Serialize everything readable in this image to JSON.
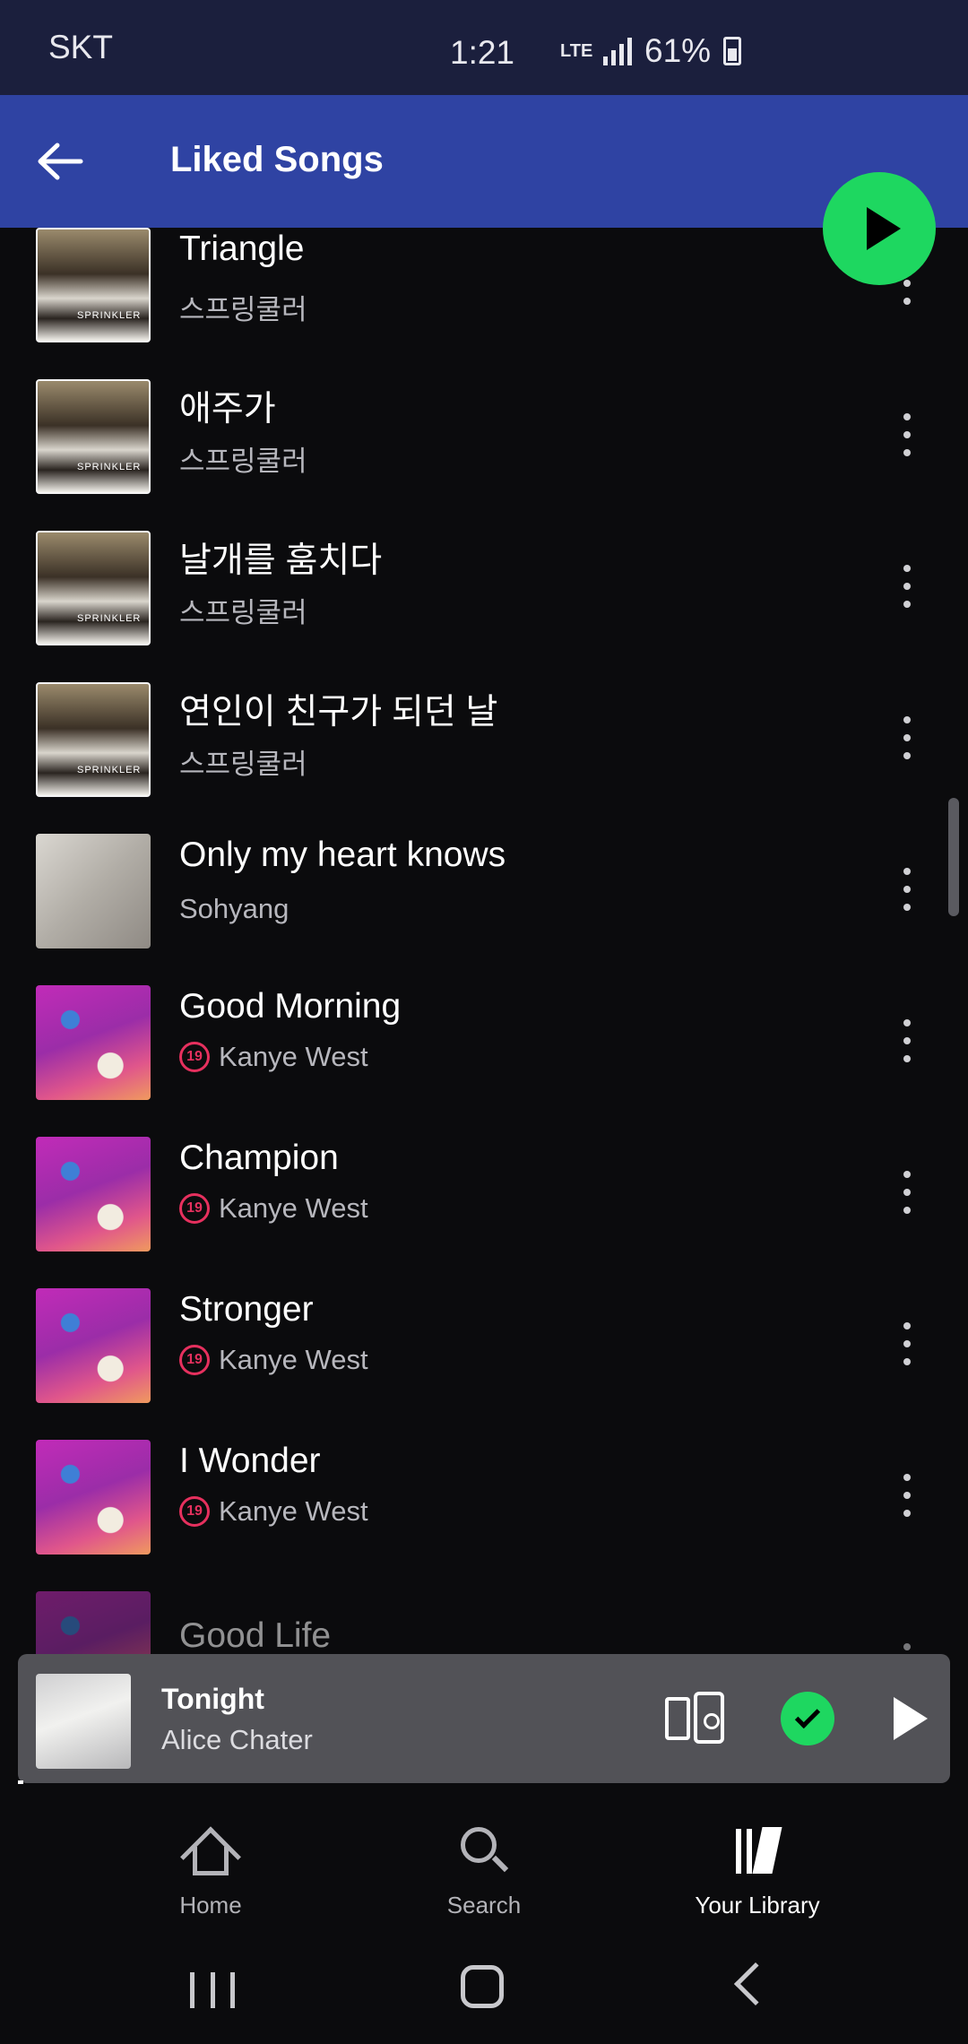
{
  "status_bar": {
    "carrier": "SKT",
    "time": "1:21",
    "network": "LTE",
    "battery": "61%"
  },
  "header": {
    "title": "Liked Songs"
  },
  "songs": [
    {
      "title": "Triangle",
      "artist": "스프링쿨러",
      "explicit": false,
      "art": "sprinkler"
    },
    {
      "title": "애주가",
      "artist": "스프링쿨러",
      "explicit": false,
      "art": "sprinkler"
    },
    {
      "title": "날개를 훔치다",
      "artist": "스프링쿨러",
      "explicit": false,
      "art": "sprinkler"
    },
    {
      "title": "연인이 친구가 되던 날",
      "artist": "스프링쿨러",
      "explicit": false,
      "art": "sprinkler"
    },
    {
      "title": "Only my heart knows",
      "artist": "Sohyang",
      "explicit": false,
      "art": "sohyang"
    },
    {
      "title": "Good Morning",
      "artist": "Kanye West",
      "explicit": true,
      "art": "kanye"
    },
    {
      "title": "Champion",
      "artist": "Kanye West",
      "explicit": true,
      "art": "kanye"
    },
    {
      "title": "Stronger",
      "artist": "Kanye West",
      "explicit": true,
      "art": "kanye"
    },
    {
      "title": "I Wonder",
      "artist": "Kanye West",
      "explicit": true,
      "art": "kanye"
    },
    {
      "title": "Good Life",
      "artist": "",
      "explicit": false,
      "art": "kanye"
    }
  ],
  "explicit_badge": "19",
  "now_playing": {
    "title": "Tonight",
    "artist": "Alice Chater"
  },
  "bottom_nav": [
    {
      "label": "Home",
      "icon": "home-icon",
      "active": false
    },
    {
      "label": "Search",
      "icon": "search-icon",
      "active": false
    },
    {
      "label": "Your Library",
      "icon": "library-icon",
      "active": true
    }
  ],
  "colors": {
    "accent": "#1ed760",
    "header_bg": "#2f43a3",
    "explicit": "#e6305e"
  }
}
